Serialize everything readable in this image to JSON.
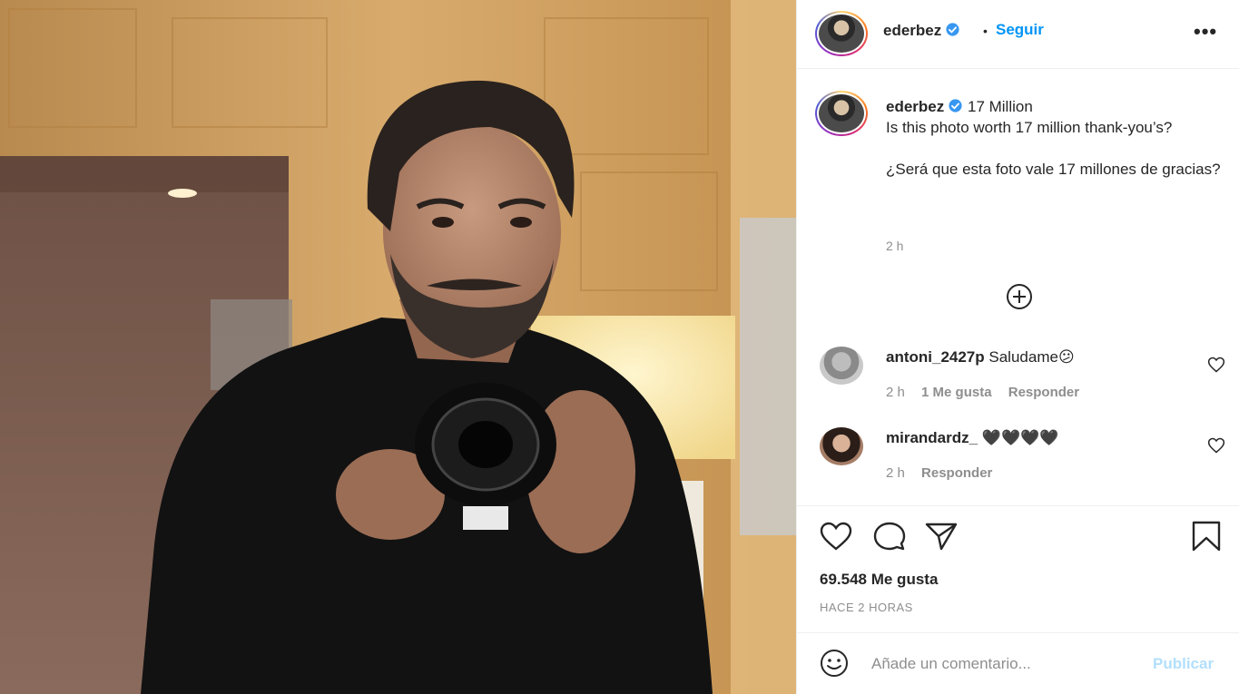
{
  "post": {
    "author": "ederbez",
    "follow_label": "Seguir",
    "separator": "•",
    "more_label": "•••",
    "caption": {
      "author": "ederbez",
      "line1": "17 Million",
      "line2": "Is this photo worth 17 million thank-you’s?",
      "line3": "¿Será que esta foto vale 17 millones de gracias?",
      "time": "2 h"
    }
  },
  "comments": [
    {
      "user": "antoni_2427p",
      "text": "Saludame😕",
      "time": "2 h",
      "likes": "1 Me gusta",
      "reply": "Responder"
    },
    {
      "user": "mirandardz_",
      "text": "🖤🖤🖤🖤",
      "time": "2 h",
      "reply": "Responder"
    }
  ],
  "stats": {
    "likes": "69.548 Me gusta",
    "ago": "HACE 2 HORAS"
  },
  "composer": {
    "placeholder": "Añade un comentario...",
    "publish_label": "Publicar"
  },
  "icons": {
    "verified": "verified-badge-icon",
    "like": "heart-icon",
    "comment": "comment-bubble-icon",
    "share": "paper-plane-icon",
    "save": "bookmark-icon",
    "load_more": "plus-circle-icon",
    "emoji": "smiley-icon"
  },
  "colors": {
    "accent": "#0095f6",
    "verified": "#3897f0",
    "muted": "#8e8e8e",
    "publish_disabled": "#b2dffc"
  }
}
